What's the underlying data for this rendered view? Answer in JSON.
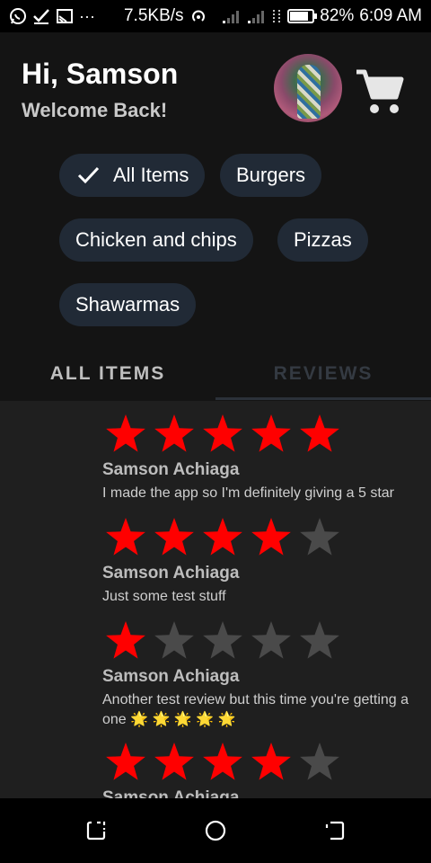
{
  "status_bar": {
    "speed": "7.5KB/s",
    "battery": "82%",
    "battery_level": 0.82,
    "time": "6:09 AM",
    "left_icons": [
      "whatsapp-icon",
      "check-icon",
      "cast-icon",
      "more-icon"
    ],
    "right_icons": [
      "hotspot-icon",
      "signal-icon",
      "signal-icon",
      "data-icon",
      "battery-icon"
    ]
  },
  "header": {
    "greeting": "Hi, Samson",
    "subtitle": "Welcome Back!"
  },
  "chips": [
    {
      "label": "All Items",
      "selected": true
    },
    {
      "label": "Burgers",
      "selected": false
    },
    {
      "label": "Chicken and chips",
      "selected": false
    },
    {
      "label": "Pizzas",
      "selected": false
    },
    {
      "label": "Shawarmas",
      "selected": false
    }
  ],
  "tabs": [
    {
      "label": "ALL ITEMS",
      "active": false
    },
    {
      "label": "REVIEWS",
      "active": true
    }
  ],
  "reviews": [
    {
      "rating": 5,
      "name": "Samson Achiaga",
      "text": "I made the app so I'm definitely giving a 5 star"
    },
    {
      "rating": 4,
      "name": "Samson Achiaga",
      "text": "Just some test stuff"
    },
    {
      "rating": 1,
      "name": "Samson Achiaga",
      "text": "Another test review but this time you're getting a one",
      "emoji": "🌟 🌟 🌟 🌟 🌟"
    },
    {
      "rating": 4,
      "name": "Samson Achiaga",
      "text": ""
    }
  ],
  "colors": {
    "star_filled": "#ff0000",
    "star_empty": "#4a4a4a",
    "chip_bg": "#212a36",
    "header_bg": "#141414",
    "list_bg": "#1f1f1f"
  },
  "nav_icons": [
    "recents-icon",
    "home-icon",
    "back-icon"
  ]
}
